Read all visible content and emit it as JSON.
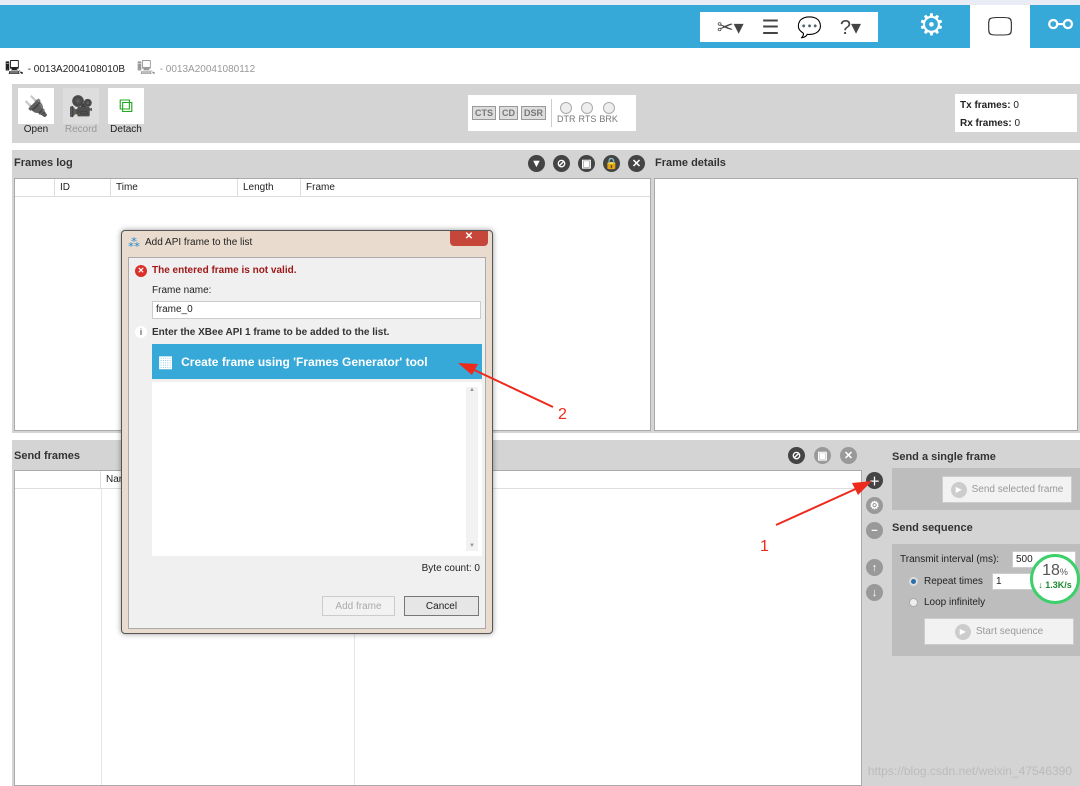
{
  "header": {
    "icons": [
      "tools-icon",
      "list-icon",
      "chat-icon",
      "help-icon"
    ],
    "nav": [
      "gear-icon",
      "console-icon",
      "network-icon"
    ],
    "brand_color": "#36a9d8"
  },
  "devices": [
    {
      "id": "- 0013A2004108010B"
    },
    {
      "id": "- 0013A20041080112"
    }
  ],
  "toolbar": {
    "open": "Open",
    "record": "Record",
    "detach": "Detach",
    "lines": [
      "CTS",
      "CD",
      "DSR"
    ],
    "leds": [
      "DTR",
      "RTS",
      "BRK"
    ],
    "tx_label": "Tx frames:",
    "tx_value": "0",
    "rx_label": "Rx frames:",
    "rx_value": "0"
  },
  "frames_log": {
    "title": "Frames log",
    "columns": [
      "ID",
      "Time",
      "Length",
      "Frame"
    ],
    "details_title": "Frame details"
  },
  "send_frames": {
    "title": "Send frames",
    "columns": [
      "Name"
    ]
  },
  "single": {
    "title": "Send a single frame",
    "button": "Send selected frame"
  },
  "sequence": {
    "title": "Send sequence",
    "interval_label": "Transmit interval (ms):",
    "interval_value": "500",
    "repeat_label": "Repeat times",
    "repeat_value": "1",
    "loop_label": "Loop infinitely",
    "start": "Start sequence"
  },
  "widget": {
    "percent": "18",
    "unit": "%",
    "speed": "↓ 1.3K/s"
  },
  "dialog": {
    "title": "Add API frame to the list",
    "error": "The entered frame is not valid.",
    "name_label": "Frame name:",
    "name_value": "frame_0",
    "info": "Enter the XBee API 1 frame to be added to the list.",
    "generator": "Create frame using 'Frames Generator' tool",
    "byte_count": "Byte count: 0",
    "add": "Add frame",
    "cancel": "Cancel"
  },
  "annotations": {
    "one": "1",
    "two": "2",
    "color": "#ee2a1c"
  },
  "watermark": "https://blog.csdn.net/weixin_47546390"
}
